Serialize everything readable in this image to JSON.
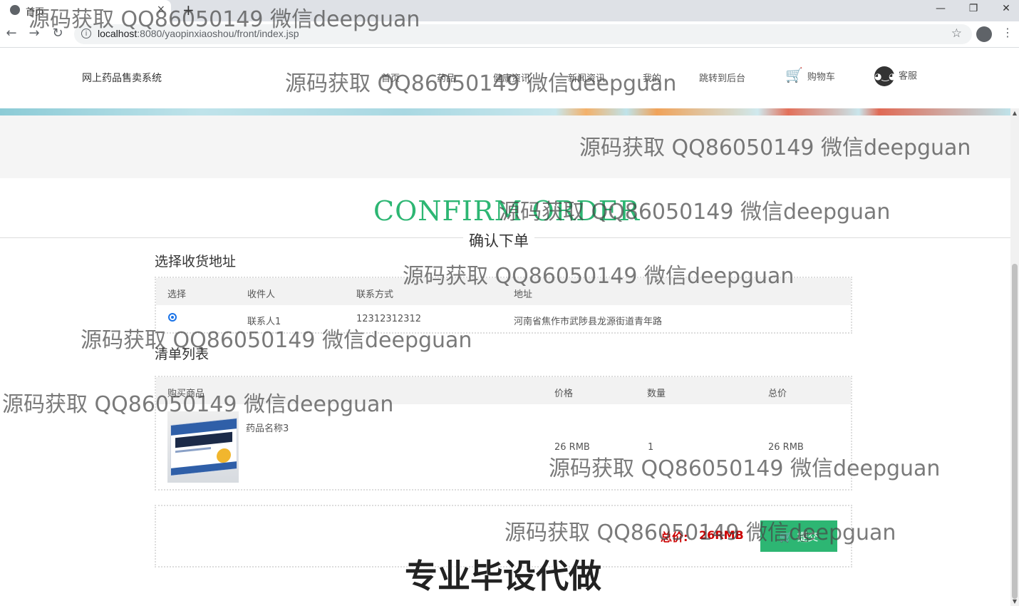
{
  "browser": {
    "tab_title": "首页",
    "tab_close": "×",
    "new_tab": "+",
    "url_host": "localhost",
    "url_rest": ":8080/yaopinxiaoshou/front/index.jsp",
    "info_icon": "i",
    "star_icon": "☆",
    "menu_icon": "⋮",
    "back_icon": "←",
    "forward_icon": "→",
    "reload_icon": "↻",
    "minimize": "—",
    "restore": "❐",
    "close": "✕"
  },
  "header": {
    "logo": "网上药品售卖系统",
    "nav": [
      "首页",
      "药品",
      "健康资讯",
      "新闻资讯",
      "我的",
      "跳转到后台"
    ],
    "cart_label": "购物车",
    "cart_icon": "🛒",
    "service_label": "客服",
    "wechat_icon": "◕‿◕"
  },
  "page": {
    "title_en": "CONFIRM ORDER",
    "title_cn": "确认下单"
  },
  "address": {
    "section_title": "选择收货地址",
    "columns": [
      "选择",
      "收件人",
      "联系方式",
      "地址"
    ],
    "rows": [
      {
        "selected": true,
        "name": "联系人1",
        "phone": "12312312312",
        "address": "河南省焦作市武陟县龙源街道青年路"
      }
    ]
  },
  "order": {
    "section_title": "清单列表",
    "columns": [
      "购买商品",
      "价格",
      "数量",
      "总价"
    ],
    "items": [
      {
        "name": "药品名称3",
        "price": "26 RMB",
        "qty": "1",
        "total": "26 RMB"
      }
    ]
  },
  "summary": {
    "total_label": "总价:",
    "total_value": "26RMB",
    "submit_label": "提交",
    "submit_icon": "🛒"
  },
  "watermark": {
    "text": "源码获取 QQ86050149 微信deepguan",
    "big": "专业毕设代做"
  },
  "colors": {
    "accent_green": "#2db673",
    "price_red": "#cc0000"
  }
}
